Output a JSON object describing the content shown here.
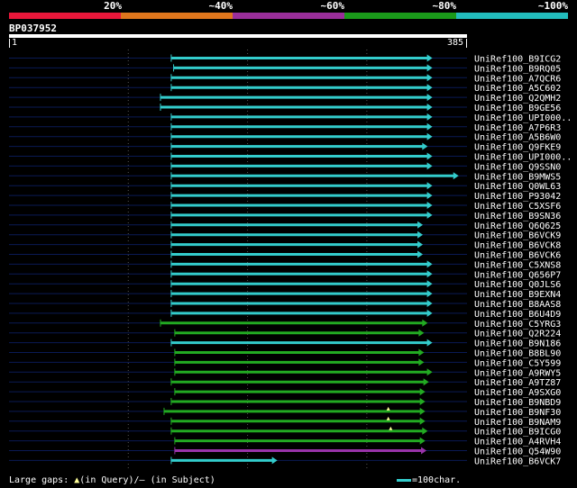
{
  "legend": {
    "labels": [
      "20%",
      "~40%",
      "~60%",
      "~80%",
      "~100%"
    ],
    "colors": [
      "#e8173a",
      "#e0761c",
      "#9a2e9a",
      "#1a9a1a",
      "#22bcbc"
    ]
  },
  "query": {
    "id": "BP037952",
    "start": "1",
    "end": "385"
  },
  "colors": {
    "background": "#000000",
    "baseline": "#0a1a55",
    "grid": "#555555",
    "cyan": "#33cccc",
    "green": "#22aa22",
    "purple": "#9933aa",
    "gap": "#ffff99"
  },
  "chart_data": {
    "type": "alignment",
    "query_length": 385,
    "hits": [
      {
        "name": "UniRef100_B9ICG2",
        "start": 137,
        "end": 356,
        "similarity": "~100%"
      },
      {
        "name": "UniRef100_B9RQ05",
        "start": 139,
        "end": 356,
        "similarity": "~100%"
      },
      {
        "name": "UniRef100_A7QCR6",
        "start": 137,
        "end": 356,
        "similarity": "~100%"
      },
      {
        "name": "UniRef100_A5C602",
        "start": 137,
        "end": 356,
        "similarity": "~100%"
      },
      {
        "name": "UniRef100_Q2QMH2",
        "start": 128,
        "end": 356,
        "similarity": "~100%"
      },
      {
        "name": "UniRef100_B9GE56",
        "start": 128,
        "end": 356,
        "similarity": "~100%"
      },
      {
        "name": "UniRef100_UPI000..",
        "start": 137,
        "end": 356,
        "similarity": "~100%"
      },
      {
        "name": "UniRef100_A7P6R3",
        "start": 137,
        "end": 356,
        "similarity": "~100%"
      },
      {
        "name": "UniRef100_A5B6W0",
        "start": 137,
        "end": 356,
        "similarity": "~100%"
      },
      {
        "name": "UniRef100_Q9FKE9",
        "start": 137,
        "end": 352,
        "similarity": "~100%"
      },
      {
        "name": "UniRef100_UPI000..",
        "start": 137,
        "end": 356,
        "similarity": "~100%"
      },
      {
        "name": "UniRef100_Q9SSN0",
        "start": 137,
        "end": 356,
        "similarity": "~100%"
      },
      {
        "name": "UniRef100_B9MWS5",
        "start": 137,
        "end": 378,
        "similarity": "~100%"
      },
      {
        "name": "UniRef100_Q0WL63",
        "start": 137,
        "end": 356,
        "similarity": "~100%"
      },
      {
        "name": "UniRef100_P93042",
        "start": 137,
        "end": 356,
        "similarity": "~100%"
      },
      {
        "name": "UniRef100_C5XSF6",
        "start": 137,
        "end": 356,
        "similarity": "~100%"
      },
      {
        "name": "UniRef100_B9SN36",
        "start": 137,
        "end": 356,
        "similarity": "~100%"
      },
      {
        "name": "UniRef100_Q6Q625",
        "start": 137,
        "end": 348,
        "similarity": "~100%"
      },
      {
        "name": "UniRef100_B6VCK9",
        "start": 137,
        "end": 348,
        "similarity": "~100%"
      },
      {
        "name": "UniRef100_B6VCK8",
        "start": 137,
        "end": 348,
        "similarity": "~100%"
      },
      {
        "name": "UniRef100_B6VCK6",
        "start": 137,
        "end": 348,
        "similarity": "~100%"
      },
      {
        "name": "UniRef100_C5XNS8",
        "start": 137,
        "end": 356,
        "similarity": "~100%"
      },
      {
        "name": "UniRef100_Q656P7",
        "start": 137,
        "end": 356,
        "similarity": "~100%"
      },
      {
        "name": "UniRef100_Q0JLS6",
        "start": 137,
        "end": 356,
        "similarity": "~100%"
      },
      {
        "name": "UniRef100_B9EXN4",
        "start": 137,
        "end": 356,
        "similarity": "~100%"
      },
      {
        "name": "UniRef100_B8AAS8",
        "start": 137,
        "end": 356,
        "similarity": "~100%"
      },
      {
        "name": "UniRef100_B6U4D9",
        "start": 137,
        "end": 356,
        "similarity": "~100%"
      },
      {
        "name": "UniRef100_C5YRG3",
        "start": 128,
        "end": 352,
        "similarity": "~80%"
      },
      {
        "name": "UniRef100_Q2R224",
        "start": 140,
        "end": 349,
        "similarity": "~80%"
      },
      {
        "name": "UniRef100_B9N186",
        "start": 137,
        "end": 356,
        "similarity": "~100%"
      },
      {
        "name": "UniRef100_B8BL90",
        "start": 140,
        "end": 349,
        "similarity": "~80%"
      },
      {
        "name": "UniRef100_C5Y599",
        "start": 140,
        "end": 349,
        "similarity": "~80%"
      },
      {
        "name": "UniRef100_A9RWY5",
        "start": 140,
        "end": 356,
        "similarity": "~80%"
      },
      {
        "name": "UniRef100_A9TZ87",
        "start": 137,
        "end": 353,
        "similarity": "~80%"
      },
      {
        "name": "UniRef100_A9SXG0",
        "start": 140,
        "end": 350,
        "similarity": "~80%"
      },
      {
        "name": "UniRef100_B9NBD9",
        "start": 137,
        "end": 350,
        "similarity": "~80%"
      },
      {
        "name": "UniRef100_B9NF30",
        "start": 131,
        "end": 350,
        "similarity": "~80%",
        "gap_at": 319
      },
      {
        "name": "UniRef100_B9NAM9",
        "start": 137,
        "end": 350,
        "similarity": "~80%",
        "gap_at": 319
      },
      {
        "name": "UniRef100_B9ICG0",
        "start": 137,
        "end": 352,
        "similarity": "~80%",
        "gap_at": 321
      },
      {
        "name": "UniRef100_A4RVH4",
        "start": 140,
        "end": 350,
        "similarity": "~80%"
      },
      {
        "name": "UniRef100_Q54W90",
        "start": 140,
        "end": 351,
        "similarity": "~60%"
      },
      {
        "name": "UniRef100_B6VCK7",
        "start": 137,
        "end": 226,
        "similarity": "~100%"
      }
    ]
  },
  "footer": {
    "large_gaps": "Large gaps:",
    "tri_glyph": "▲",
    "in_query": "(in Query)/",
    "dash_glyph": "—",
    "in_subject": " (in Subject)",
    "scale": "=100char."
  }
}
